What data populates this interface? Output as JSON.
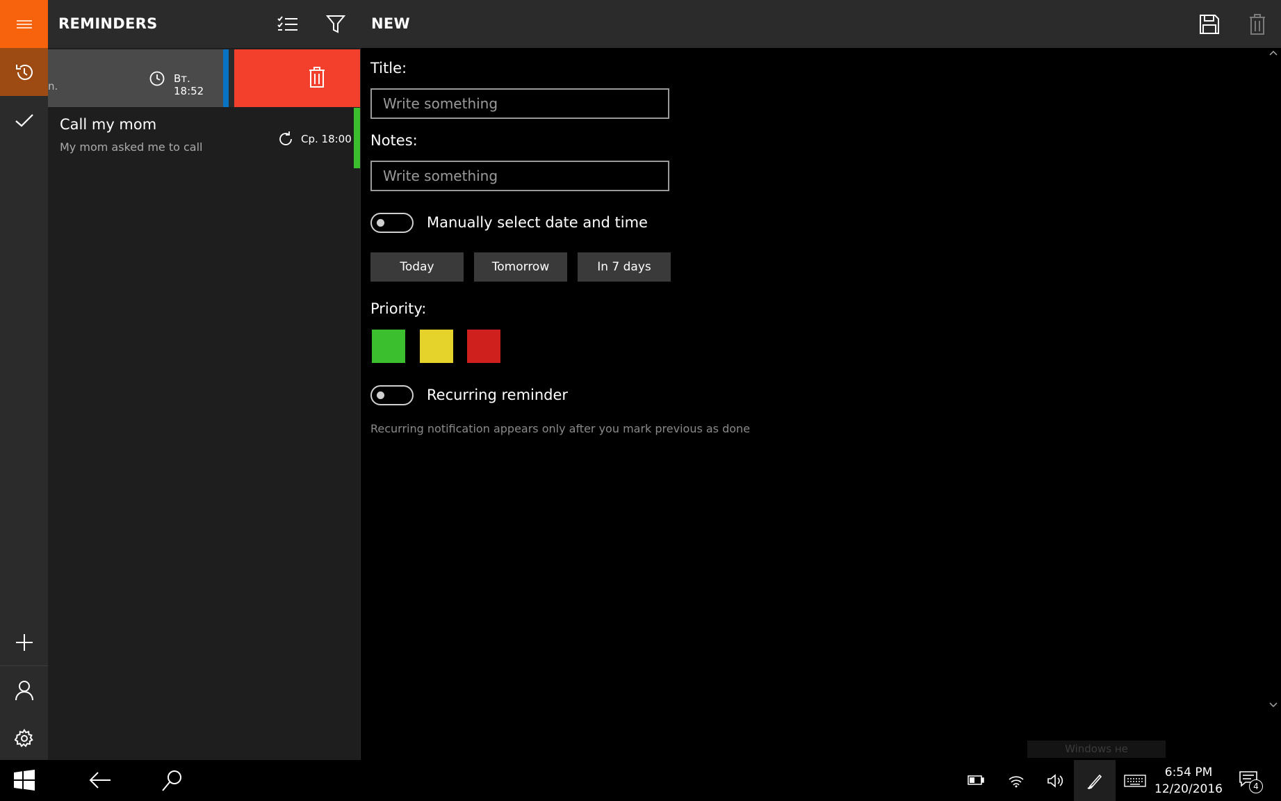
{
  "app": {
    "list_title": "REMINDERS",
    "detail_title": "NEW"
  },
  "colors": {
    "accent": "#f7630c",
    "delete": "#f2402c",
    "priority_low": "#3bbf2f",
    "priority_medium": "#e5d32b",
    "priority_high": "#d0201d",
    "item_blue": "#0a74c4",
    "item_green": "#3bbf2f"
  },
  "rail": {
    "icons": [
      "hamburger-icon",
      "history-icon",
      "checkmark-icon",
      "plus-icon",
      "person-icon",
      "gear-icon"
    ]
  },
  "list": {
    "items": [
      {
        "title_fragment": "n.",
        "time": "Вт. 18:52",
        "icon": "clock-icon",
        "priority_color": "#0a74c4",
        "swiped": true,
        "swipe_action": "trash-icon"
      },
      {
        "title": "Call my mom",
        "notes": "My mom asked me to call",
        "time": "Ср. 18:00",
        "icon": "recurring-icon",
        "priority_color": "#3bbf2f"
      }
    ]
  },
  "form": {
    "title_label": "Title:",
    "title_placeholder": "Write something",
    "title_value": "",
    "notes_label": "Notes:",
    "notes_placeholder": "Write something",
    "notes_value": "",
    "manual_toggle_label": "Manually select date and time",
    "manual_toggle_on": false,
    "quick_dates": [
      "Today",
      "Tomorrow",
      "In 7 days"
    ],
    "priority_label": "Priority:",
    "recurring_toggle_label": "Recurring reminder",
    "recurring_toggle_on": false,
    "recurring_hint": "Recurring notification appears only after you mark previous as done"
  },
  "taskbar": {
    "time": "6:54 PM",
    "date": "12/20/2016",
    "notifications": "4",
    "watermark": "Windows не активирована"
  }
}
